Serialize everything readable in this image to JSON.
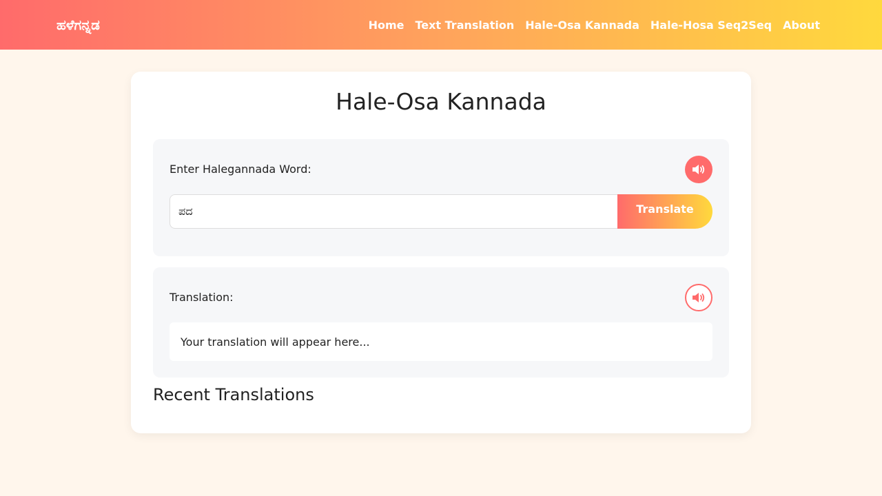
{
  "nav": {
    "brand": "ಹಳೆಗನ್ನಡ",
    "links": [
      "Home",
      "Text Translation",
      "Hale-Osa Kannada",
      "Hale-Hosa Seq2Seq",
      "About"
    ]
  },
  "main": {
    "title": "Hale-Osa Kannada",
    "input_label": "Enter Halegannada Word:",
    "input_value": "ಪದ",
    "translate_label": "Translate",
    "output_label": "Translation:",
    "output_placeholder": "Your translation will appear here...",
    "recent_title": "Recent Translations"
  },
  "icons": {
    "input_speaker": "speaker-icon",
    "output_speaker": "speaker-icon"
  },
  "colors": {
    "accent": "#ff6b6b",
    "accent_end": "#ffd93d",
    "background": "#fff6ec"
  }
}
